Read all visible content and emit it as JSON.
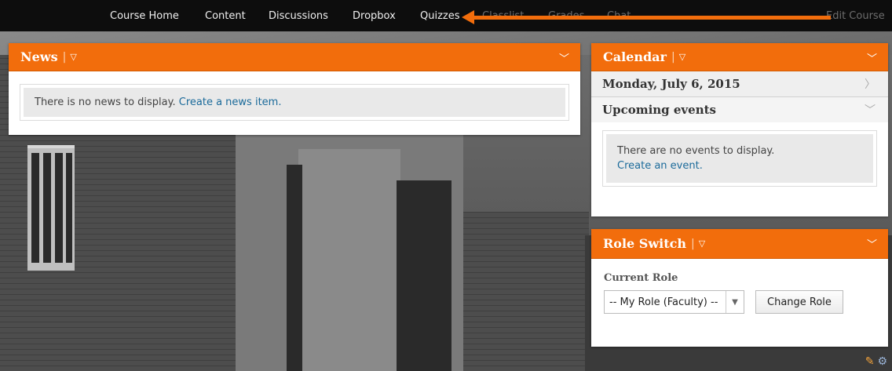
{
  "nav": {
    "items": [
      {
        "label": "Course Home",
        "active": true
      },
      {
        "label": "Content",
        "active": true
      },
      {
        "label": "Discussions",
        "active": true
      },
      {
        "label": "Dropbox",
        "active": true
      },
      {
        "label": "Quizzes",
        "active": true
      },
      {
        "label": "Classlist",
        "active": false
      },
      {
        "label": "Grades",
        "active": false
      },
      {
        "label": "Chat",
        "active": false
      },
      {
        "label": "Edit Course",
        "active": true
      }
    ],
    "arrow_color": "#f26d0c"
  },
  "news": {
    "title": "News",
    "menu_icon": "triangle-down-icon",
    "empty_text": "There is no news to display.",
    "create_link": "Create a news item."
  },
  "calendar": {
    "title": "Calendar",
    "date": "Monday, July 6, 2015",
    "upcoming": "Upcoming events",
    "empty_text": "There are no events to display.",
    "create_link": "Create an event."
  },
  "role_switch": {
    "title": "Role Switch",
    "current_role_label": "Current Role",
    "selected_role": "-- My Role (Faculty) --",
    "change_button": "Change Role"
  },
  "colors": {
    "accent": "#f26d0c",
    "nav_bg": "#0d0d0d",
    "link": "#1a6a9a"
  }
}
